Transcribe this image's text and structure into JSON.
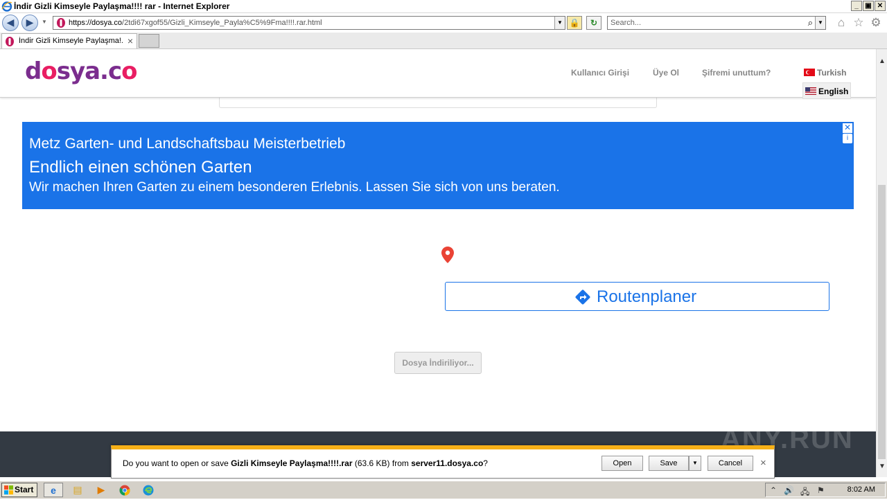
{
  "window": {
    "title": "İndir Gizli Kimseyle Paylaşma!!!! rar - Internet Explorer",
    "btn_min": "_",
    "btn_max": "▣",
    "btn_close": "✕"
  },
  "toolbar": {
    "back": "◀",
    "forward": "▶",
    "url_host": "https://dosya.co",
    "url_path": "/2tdi67xgof55/Gizli_Kimseyle_Payla%C5%9Fma!!!!.rar.html",
    "lock": "🔒",
    "refresh": "↻",
    "search_placeholder": "Search...",
    "search_icon": "⌕",
    "dropdown": "▼",
    "home": "⌂",
    "favorites": "☆",
    "settings": "⚙"
  },
  "tab": {
    "label": "İndir Gizli Kimseyle Paylaşma!...",
    "close": "×"
  },
  "site": {
    "logo_text": "dosya.co",
    "nav": {
      "login": "Kullanıcı Girişi",
      "register": "Üye Ol",
      "forgot": "Şifremi unuttum?"
    },
    "lang_turkish": "Turkish",
    "lang_english": "English"
  },
  "ad": {
    "line1": "Metz Garten- und Landschaftsbau Meisterbetrieb",
    "line2": "Endlich einen schönen Garten",
    "line3": "Wir machen Ihren Garten zu einem besonderen Erlebnis. Lassen Sie sich von uns beraten.",
    "close": "✕",
    "info": "i",
    "route_label": "Routenplaner"
  },
  "download_button": "Dosya İndiriliyor...",
  "notification": {
    "pre": "Do you want to open or save ",
    "filename": "Gizli Kimseyle Paylaşma!!!!.rar",
    "size": " (63.6 KB) from ",
    "server": "server11.dosya.co",
    "post": "?",
    "open": "Open",
    "save": "Save",
    "save_dd": "▼",
    "cancel": "Cancel",
    "close": "×"
  },
  "watermark": "ANY.RUN",
  "scroll": {
    "up": "▲",
    "down": "▼"
  },
  "taskbar": {
    "start": "Start",
    "clock": "8:02 AM",
    "tray_expand": "⌃",
    "volume": "🔊",
    "network": "🖧",
    "flag": "⚑"
  },
  "colors": {
    "brand_purple": "#7b2d8e",
    "brand_pink": "#e91e63",
    "ad_blue": "#1a73e8",
    "notif_bar": "#f6b017",
    "footer": "#333a43"
  }
}
